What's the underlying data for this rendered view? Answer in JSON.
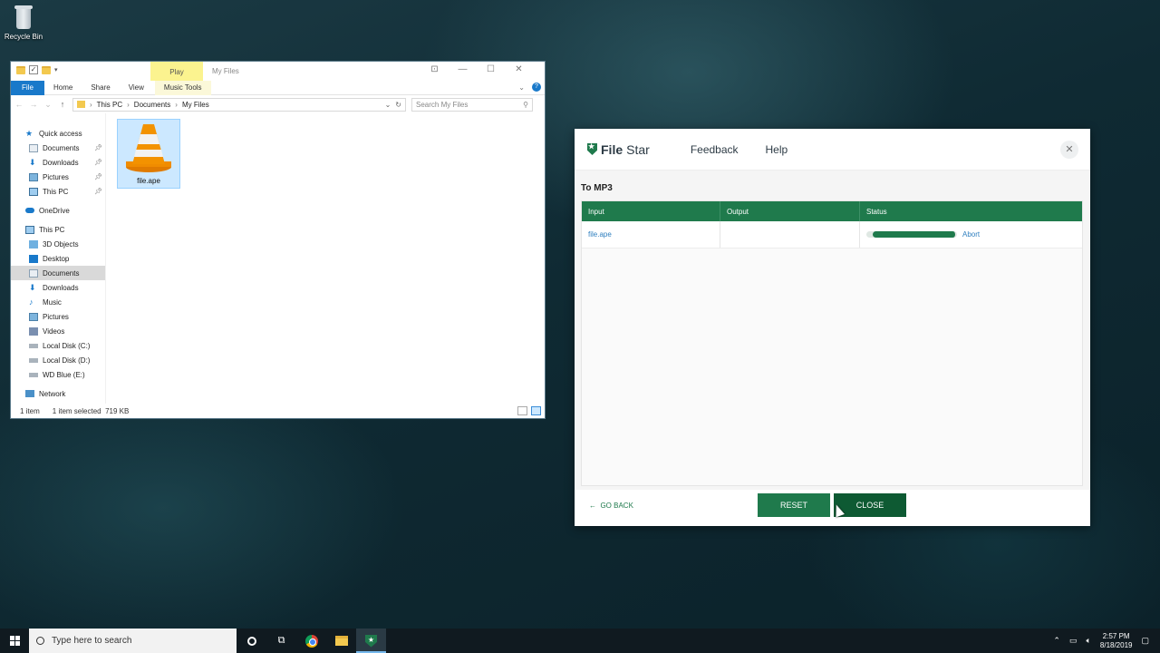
{
  "desktop": {
    "recycle_bin": "Recycle Bin"
  },
  "explorer": {
    "window_title": "My Files",
    "context_tab": "Play",
    "ribbon_tabs": [
      "File",
      "Home",
      "Share",
      "View",
      "Music Tools"
    ],
    "breadcrumb": [
      "This PC",
      "Documents",
      "My Files"
    ],
    "search_placeholder": "Search My Files",
    "nav": {
      "quick_access": "Quick access",
      "qa_items": [
        "Documents",
        "Downloads",
        "Pictures",
        "This PC"
      ],
      "onedrive": "OneDrive",
      "this_pc": "This PC",
      "pc_items": [
        "3D Objects",
        "Desktop",
        "Documents",
        "Downloads",
        "Music",
        "Pictures",
        "Videos",
        "Local Disk (C:)",
        "Local Disk (D:)",
        "WD Blue (E:)"
      ],
      "network": "Network"
    },
    "file_name": "file.ape",
    "status": {
      "count": "1 item",
      "selected": "1 item selected",
      "size": "719 KB"
    }
  },
  "filestar": {
    "brand_a": "File",
    "brand_b": "Star",
    "menu": [
      "Feedback",
      "Help"
    ],
    "heading": "To MP3",
    "columns": [
      "Input",
      "Output",
      "Status"
    ],
    "row": {
      "input": "file.ape",
      "output": "",
      "progress": 1.0,
      "action": "Abort"
    },
    "go_back": "GO BACK",
    "reset": "RESET",
    "close": "CLOSE",
    "accent": "#1f7a4c"
  },
  "taskbar": {
    "search_placeholder": "Type here to search",
    "time": "2:57 PM",
    "date": "8/18/2019"
  }
}
